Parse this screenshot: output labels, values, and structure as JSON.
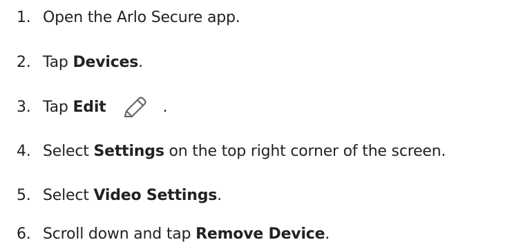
{
  "steps": [
    {
      "num": "1.",
      "pre": "Open the Arlo Secure app.",
      "bold": "",
      "post": ""
    },
    {
      "num": "2.",
      "pre": "Tap ",
      "bold": "Devices",
      "post": "."
    },
    {
      "num": "3.",
      "pre": "Tap ",
      "bold": "Edit",
      "icon": "pencil-icon",
      "post": "."
    },
    {
      "num": "4.",
      "pre": "Select ",
      "bold": "Settings",
      "post": " on the top right corner of the screen."
    },
    {
      "num": "5.",
      "pre": "Select ",
      "bold": "Video Settings",
      "post": "."
    },
    {
      "num": "6.",
      "pre": "Scroll down and tap ",
      "bold": "Remove Device",
      "post": "."
    }
  ],
  "colors": {
    "text": "#222222",
    "icon": "#666666"
  }
}
